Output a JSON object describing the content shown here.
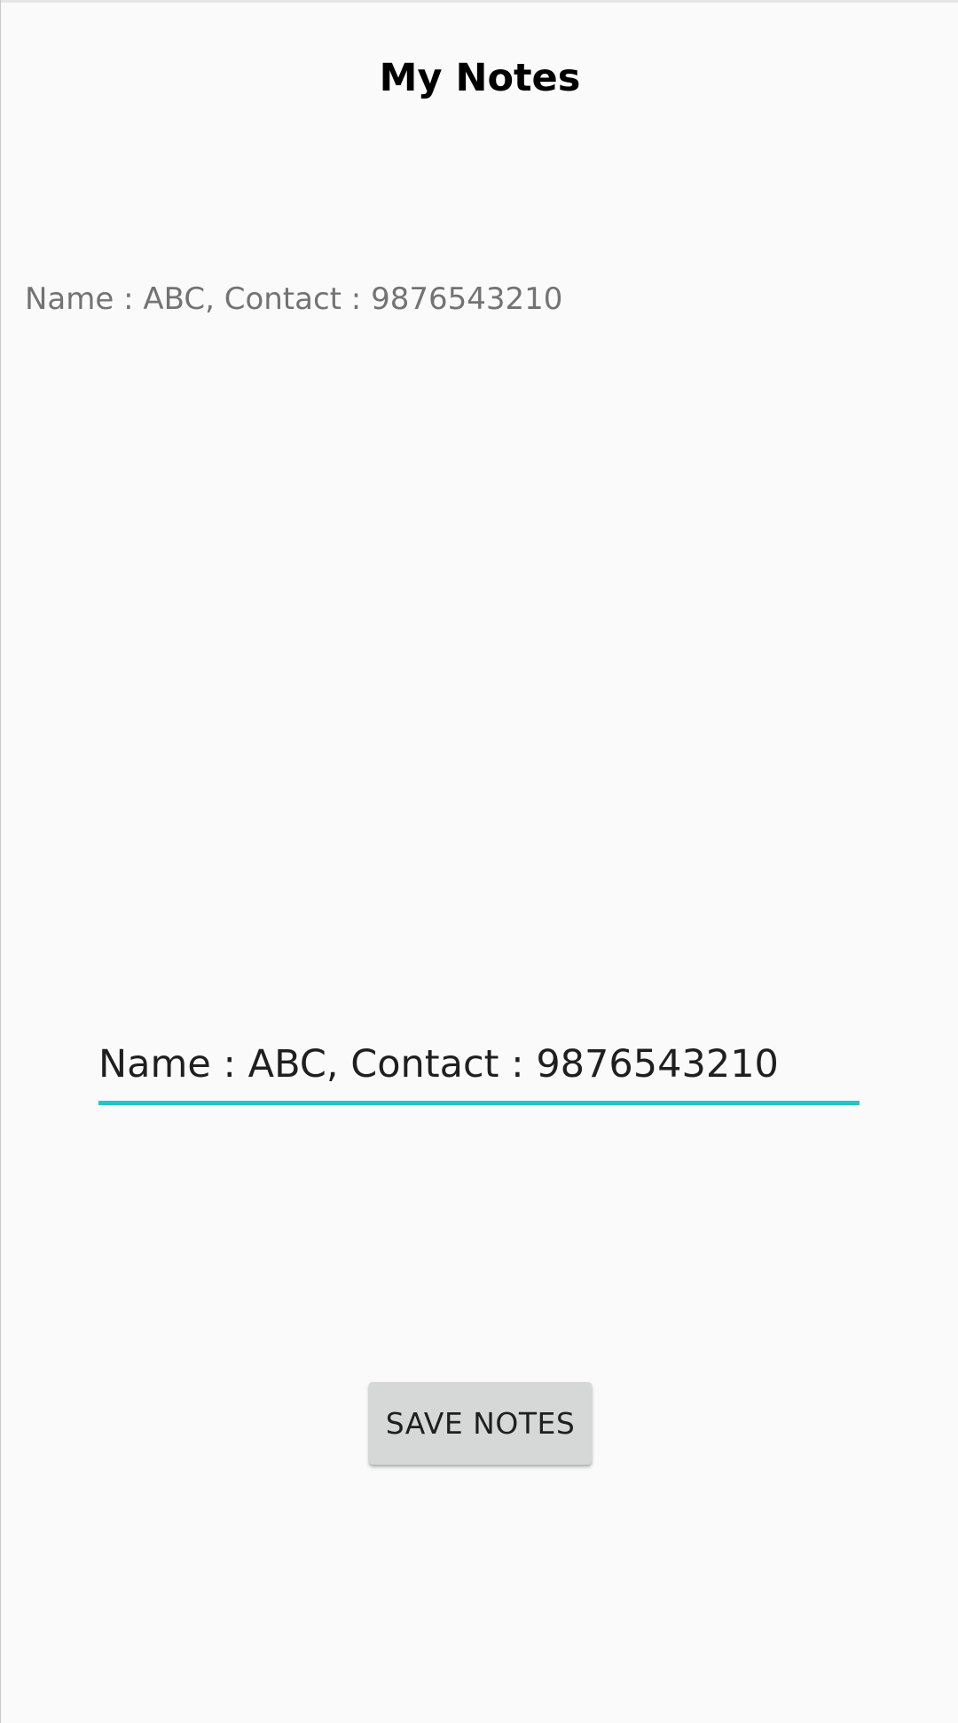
{
  "header": {
    "title": "My Notes"
  },
  "saved_note": {
    "text": "Name : ABC, Contact : 9876543210"
  },
  "note_input": {
    "value": "Name : ABC, Contact : 9876543210",
    "accent_color": "#26c6c0"
  },
  "actions": {
    "save_label": "SAVE NOTES"
  },
  "theme": {
    "background": "#fafafa",
    "button_background": "#d6d7d7",
    "secondary_text": "#737373"
  }
}
